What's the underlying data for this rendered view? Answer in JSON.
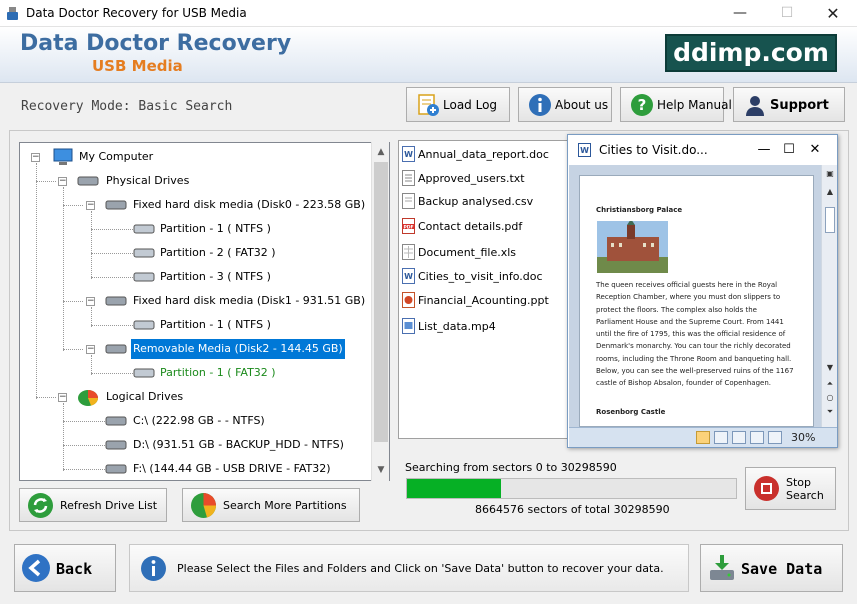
{
  "window": {
    "title": "Data Doctor Recovery for USB Media",
    "minimize": "—",
    "maximize": "☐",
    "close": "✕"
  },
  "banner": {
    "brand": "Data Doctor Recovery",
    "sub": "USB Media",
    "site": "ddimp.com"
  },
  "mode": "Recovery Mode: Basic Search",
  "toolbar": {
    "load_log": "Load Log",
    "about": "About us",
    "help": "Help Manual",
    "support": "Support"
  },
  "tree": {
    "root": "My Computer",
    "physical": "Physical Drives",
    "disk0": "Fixed hard disk media (Disk0 - 223.58 GB)",
    "d0p1": "Partition - 1 ( NTFS )",
    "d0p2": "Partition - 2 ( FAT32 )",
    "d0p3": "Partition - 3 ( NTFS )",
    "disk1": "Fixed hard disk media (Disk1 - 931.51 GB)",
    "d1p1": "Partition - 1 ( NTFS )",
    "disk2": "Removable Media (Disk2 - 144.45 GB)",
    "d2p1": "Partition - 1 ( FAT32 )",
    "logical": "Logical Drives",
    "c": "C:\\ (222.98 GB -  - NTFS)",
    "d": "D:\\ (931.51 GB - BACKUP_HDD - NTFS)",
    "f": "F:\\ (144.44 GB - USB DRIVE - FAT32)"
  },
  "buttons": {
    "refresh": "Refresh Drive List",
    "search_more": "Search More Partitions",
    "stop": "Stop Search",
    "back": "Back",
    "save": "Save Data"
  },
  "files": [
    {
      "name": "Annual_data_report.doc",
      "icon": "word-doc-icon"
    },
    {
      "name": "Approved_users.txt",
      "icon": "text-file-icon"
    },
    {
      "name": "Backup analysed.csv",
      "icon": "csv-file-icon"
    },
    {
      "name": "Contact details.pdf",
      "icon": "pdf-file-icon"
    },
    {
      "name": "Document_file.xls",
      "icon": "excel-file-icon"
    },
    {
      "name": "Cities_to_visit_info.doc",
      "icon": "word-doc-icon"
    },
    {
      "name": "Financial_Acounting.ppt",
      "icon": "powerpoint-file-icon"
    },
    {
      "name": "List_data.mp4",
      "icon": "video-file-icon"
    }
  ],
  "viewer": {
    "title": "Cities to Visit.do...",
    "heading1": "Christiansborg Palace",
    "body": "The queen receives official guests here in the Royal Reception Chamber, where you must don slippers to protect the floors. The complex also holds the Parliament House and the Supreme Court. From 1441 until the fire of 1795, this was the official residence of Denmark's monarchy. You can tour the richly decorated rooms, including the Throne Room and banqueting hall. Below, you can see the well-preserved ruins of the 1167 castle of Bishop Absalon, founder of Copenhagen.",
    "heading2": "Rosenborg Castle",
    "zoom": "30%"
  },
  "progress": {
    "label": "Searching from sectors     0 to 30298590",
    "sectors": "8664576   sectors  of  total 30298590",
    "fraction": 0.286
  },
  "info": "Please Select the Files and Folders and Click on 'Save Data' button to recover your data.",
  "colors": {
    "accent": "#0078d7",
    "progress": "#06b025",
    "brand": "#3d6da1",
    "brand_sub": "#e57d20",
    "site_bg": "#17534f"
  }
}
